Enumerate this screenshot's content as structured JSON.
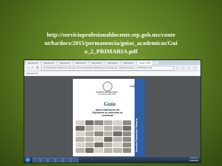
{
  "caption": {
    "line1": "http://servicioprofesionaldocente.sep.gob.mx/conte",
    "line2": "nt/ba/docs/2015/permanencia/guias_academicas/Gui",
    "line3": "a_2_PRIMARIA.pdf"
  },
  "browser": {
    "tabs": [
      {
        "label": "Servicio Pr..."
      },
      {
        "label": "Servicio Pr..."
      },
      {
        "label": "Servicio Pr..."
      },
      {
        "label": "Servicio Pr..."
      },
      {
        "label": "Servicio Pr..."
      },
      {
        "label": "Servicio Pr..."
      },
      {
        "label": "Servicio Pr..."
      },
      {
        "label": "Guia_2_PR..."
      }
    ],
    "address": "servicioprofesionaldocente.sep.gob.mx/content/ba/docs/2015/permanencia/guias_academicas/Guia_2_PRIMARIA.pdf",
    "bookmark": "Aplicaciones"
  },
  "pdf": {
    "header_line1": "Evaluación del Desempeño",
    "header_line2": "Ciclo Escolar 2015-2016",
    "agency": "CNSPD",
    "title": "Guía",
    "subtitle_line1": "para la elaboración del",
    "subtitle_line2": "Expediente de evidencias de",
    "subtitle_line3": "enseñanza",
    "stripe_text": "Docente Educación Primaria"
  },
  "taskbar": {
    "time": "11:39 a.m.",
    "date": "11/09/2015"
  }
}
